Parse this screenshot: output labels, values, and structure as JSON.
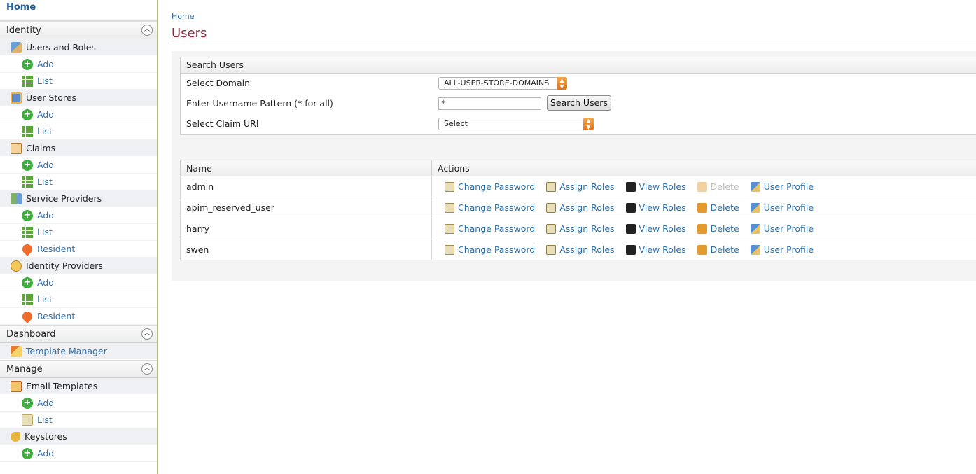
{
  "sidebar": {
    "home": "Home",
    "identity": {
      "title": "Identity",
      "groups": [
        {
          "label": "Users and Roles",
          "icon": "users-roles-icon",
          "items": [
            {
              "label": "Add",
              "icon": "add-icon"
            },
            {
              "label": "List",
              "icon": "list-icon"
            }
          ]
        },
        {
          "label": "User Stores",
          "icon": "user-stores-icon",
          "items": [
            {
              "label": "Add",
              "icon": "add-icon"
            },
            {
              "label": "List",
              "icon": "list-icon"
            }
          ]
        },
        {
          "label": "Claims",
          "icon": "claims-icon",
          "items": [
            {
              "label": "Add",
              "icon": "add-icon"
            },
            {
              "label": "List",
              "icon": "list-icon"
            }
          ]
        },
        {
          "label": "Service Providers",
          "icon": "service-providers-icon",
          "items": [
            {
              "label": "Add",
              "icon": "add-icon"
            },
            {
              "label": "List",
              "icon": "list-icon"
            },
            {
              "label": "Resident",
              "icon": "resident-icon"
            }
          ]
        },
        {
          "label": "Identity Providers",
          "icon": "identity-providers-icon",
          "items": [
            {
              "label": "Add",
              "icon": "add-icon"
            },
            {
              "label": "List",
              "icon": "list-icon"
            },
            {
              "label": "Resident",
              "icon": "resident-icon"
            }
          ]
        }
      ]
    },
    "dashboard": {
      "title": "Dashboard",
      "items": [
        {
          "label": "Template Manager",
          "icon": "template-manager-icon"
        }
      ]
    },
    "manage": {
      "title": "Manage",
      "groups": [
        {
          "label": "Email Templates",
          "icon": "email-templates-icon",
          "items": [
            {
              "label": "Add",
              "icon": "add-icon"
            },
            {
              "label": "List",
              "icon": "edit-list-icon"
            }
          ]
        },
        {
          "label": "Keystores",
          "icon": "keystores-icon",
          "items": [
            {
              "label": "Add",
              "icon": "add-icon"
            }
          ]
        }
      ]
    }
  },
  "breadcrumb": "Home",
  "page_title": "Users",
  "search": {
    "heading": "Search Users",
    "domain_label": "Select Domain",
    "domain_value": "ALL-USER-STORE-DOMAINS",
    "pattern_label": "Enter Username Pattern (* for all)",
    "pattern_value": "*",
    "button": "Search Users",
    "claim_label": "Select Claim URI",
    "claim_value": "Select"
  },
  "table": {
    "columns": [
      "Name",
      "Actions"
    ],
    "actions": [
      "Change Password",
      "Assign Roles",
      "View Roles",
      "Delete",
      "User Profile"
    ],
    "rows": [
      {
        "name": "admin",
        "delete_disabled": true
      },
      {
        "name": "apim_reserved_user",
        "delete_disabled": false
      },
      {
        "name": "harry",
        "delete_disabled": false
      },
      {
        "name": "swen",
        "delete_disabled": false
      }
    ]
  },
  "colors": {
    "title": "#8b2a3c",
    "link": "#2f6fa8",
    "sidebar_border": "#a9c27a"
  }
}
